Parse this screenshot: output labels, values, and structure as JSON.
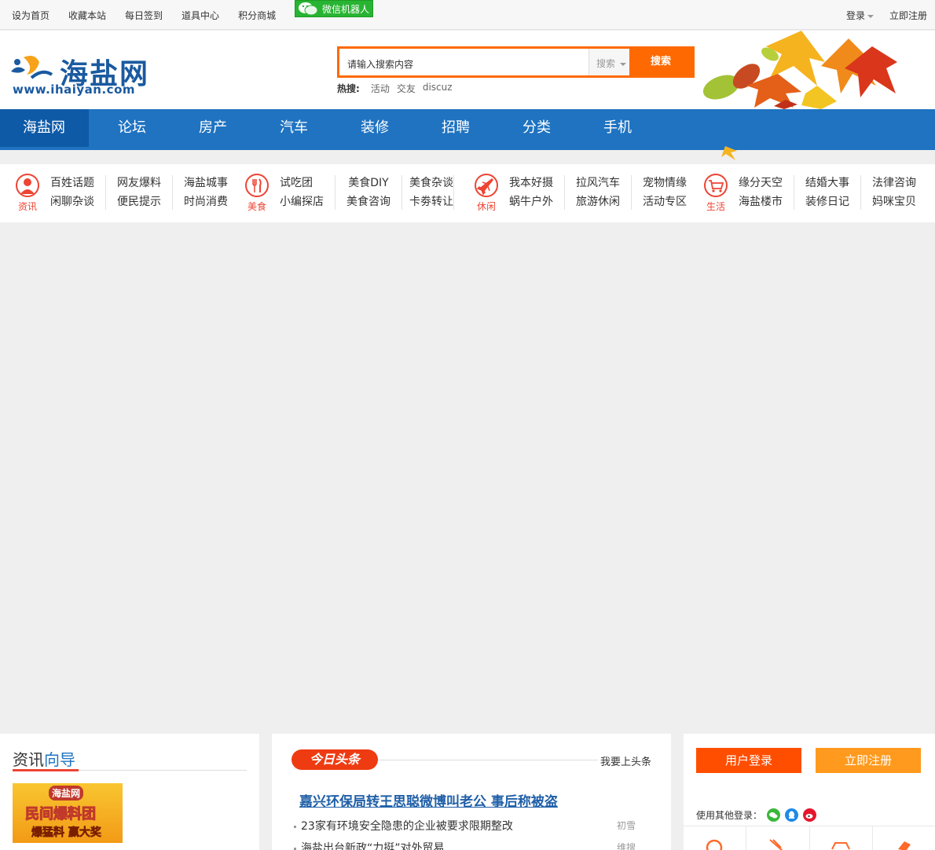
{
  "topbar": {
    "links": [
      "设为首页",
      "收藏本站",
      "每日签到",
      "道具中心",
      "积分商城"
    ],
    "wechat_robot": "微信机器人",
    "login": "登录",
    "register": "立即注册"
  },
  "header": {
    "logo_text": "海盐网",
    "logo_url": "www.ihaiyan.com",
    "search_placeholder": "请输入搜索内容",
    "search_type": "搜索",
    "search_button": "搜索",
    "hot_label": "热搜:",
    "hot_terms": [
      "活动",
      "交友",
      "discuz"
    ]
  },
  "mainnav": [
    "海盐网",
    "论坛",
    "房产",
    "汽车",
    "装修",
    "招聘",
    "分类",
    "手机"
  ],
  "subnav": {
    "categories": [
      {
        "label": "资讯",
        "icon": "person-icon",
        "groups": [
          [
            "百姓话题",
            "闲聊杂谈"
          ],
          [
            "网友爆料",
            "便民提示"
          ],
          [
            "海盐城事",
            "时尚消费"
          ]
        ]
      },
      {
        "label": "美食",
        "icon": "fork-knife-icon",
        "groups": [
          [
            "试吃团",
            "小编探店"
          ],
          [
            "美食DIY",
            "美食咨询"
          ],
          [
            "美食杂谈",
            "卡劵转让"
          ]
        ]
      },
      {
        "label": "休闲",
        "icon": "airplane-icon",
        "groups": [
          [
            "我本好摄",
            "蜗牛户外"
          ],
          [
            "拉风汽车",
            "旅游休闲"
          ],
          [
            "宠物情缘",
            "活动专区"
          ]
        ]
      },
      {
        "label": "生活",
        "icon": "cart-icon",
        "groups": [
          [
            "缘分天空",
            "海盐楼市"
          ],
          [
            "结婚大事",
            "装修日记"
          ],
          [
            "法律咨询",
            "妈咪宝贝"
          ]
        ]
      }
    ]
  },
  "guide": {
    "title_a": "资讯",
    "title_b": "向导",
    "banner": {
      "t1": "海盐网",
      "t2": "民间爆料团",
      "t3": "爆猛料 赢大奖"
    }
  },
  "headlines": {
    "badge": "今日头条",
    "link": "我要上头条",
    "top": "嘉兴环保局转王思聪微博叫老公 事后称被盗",
    "items": [
      {
        "title": "23家有环境安全隐患的企业被要求限期整改",
        "author": "初雪"
      },
      {
        "title": "海盐出台新政“力挺”对外贸易",
        "author": "维搜"
      }
    ]
  },
  "user": {
    "login": "用户登录",
    "register": "立即注册",
    "other_login": "使用其他登录：",
    "social": [
      "wechat-icon",
      "qq-icon",
      "weibo-icon"
    ]
  },
  "colors": {
    "brand_blue": "#1f73c1",
    "accent_orange": "#fe6a01",
    "red": "#ee4433"
  }
}
